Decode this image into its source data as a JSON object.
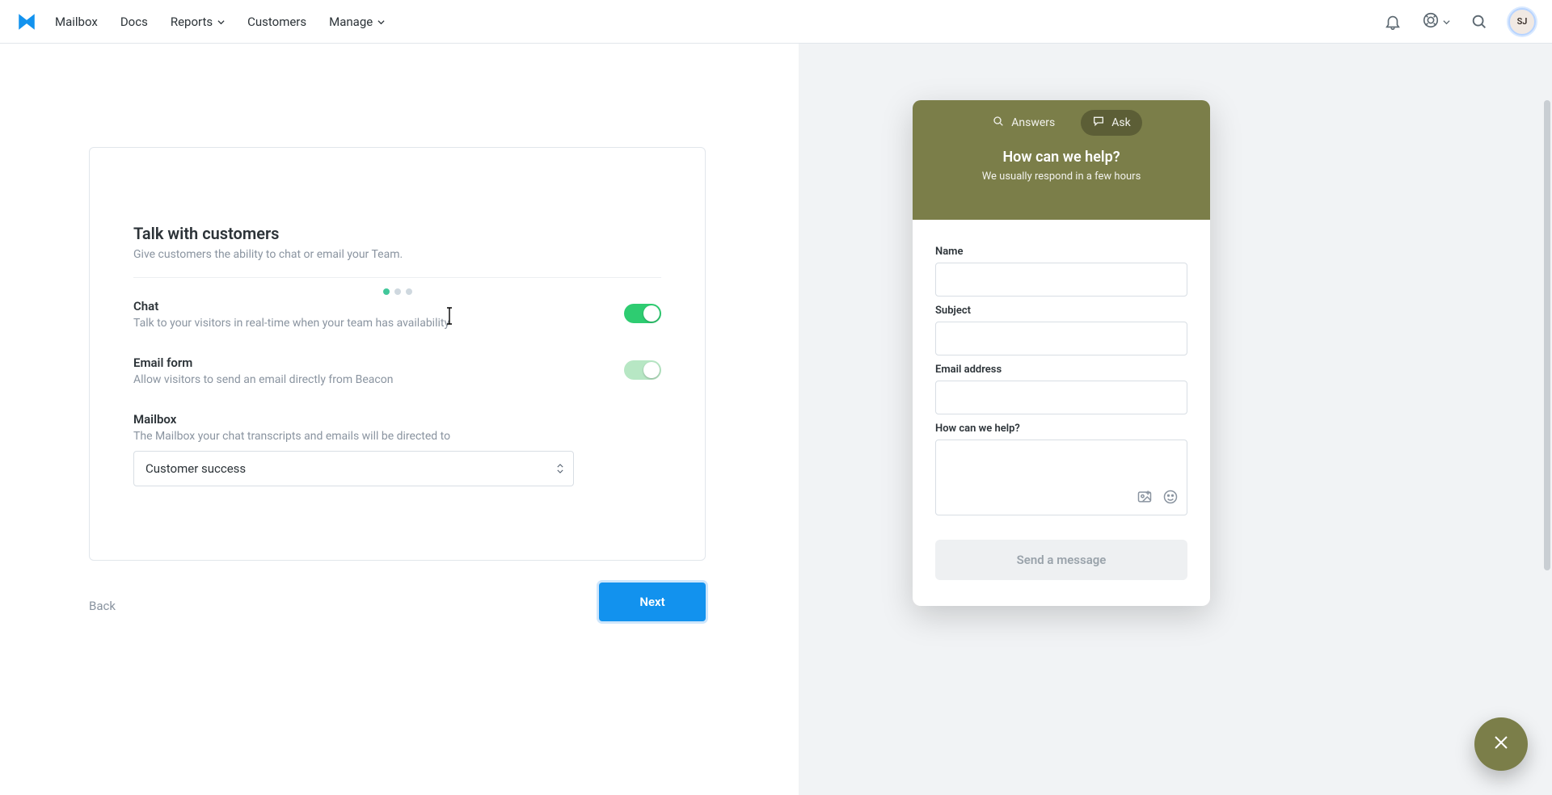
{
  "nav": {
    "mailbox": "Mailbox",
    "docs": "Docs",
    "reports": "Reports",
    "customers": "Customers",
    "manage": "Manage"
  },
  "avatar_initials": "SJ",
  "card": {
    "title": "Talk with customers",
    "subtitle": "Give customers the ability to chat or email your Team.",
    "chat": {
      "label": "Chat",
      "desc": "Talk to your visitors in real-time when your team has availability",
      "enabled": true
    },
    "email_form": {
      "label": "Email form",
      "desc": "Allow visitors to send an email directly from Beacon",
      "enabled": true
    },
    "mailbox": {
      "label": "Mailbox",
      "desc": "The Mailbox your chat transcripts and emails will be directed to",
      "selected": "Customer success"
    }
  },
  "footer": {
    "back": "Back",
    "next": "Next"
  },
  "widget": {
    "tab_answers": "Answers",
    "tab_ask": "Ask",
    "title": "How can we help?",
    "subtitle": "We usually respond in a few hours",
    "name_label": "Name",
    "subject_label": "Subject",
    "email_label": "Email address",
    "help_label": "How can we help?",
    "send": "Send a message"
  }
}
